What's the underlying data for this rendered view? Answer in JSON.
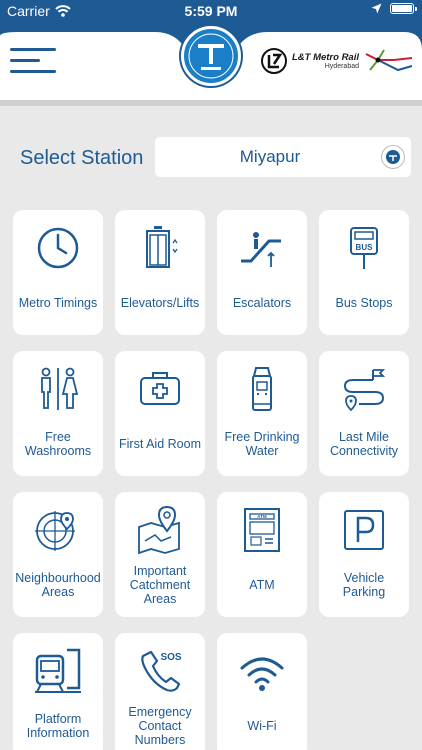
{
  "status_bar": {
    "carrier": "Carrier",
    "time": "5:59 PM"
  },
  "header": {
    "menu_icon": "hamburger-menu-icon",
    "logo_icon": "tsavaari-logo-icon",
    "brand_name": "L&T Metro Rail",
    "brand_city": "Hyderabad"
  },
  "station_select": {
    "label": "Select Station",
    "value": "Miyapur"
  },
  "tiles": [
    {
      "label": "Metro Timings",
      "icon": "clock-icon"
    },
    {
      "label": "Elevators/Lifts",
      "icon": "elevator-icon"
    },
    {
      "label": "Escalators",
      "icon": "escalator-icon"
    },
    {
      "label": "Bus Stops",
      "icon": "bus-stop-icon"
    },
    {
      "label": "Free Washrooms",
      "icon": "washroom-icon"
    },
    {
      "label": "First Aid Room",
      "icon": "first-aid-kit-icon"
    },
    {
      "label": "Free Drinking Water",
      "icon": "water-dispenser-icon"
    },
    {
      "label": "Last Mile Connectivity",
      "icon": "route-icon"
    },
    {
      "label": "Neighbourhood Areas",
      "icon": "neighbourhood-radar-icon"
    },
    {
      "label": "Important Catchment Areas",
      "icon": "map-pin-icon"
    },
    {
      "label": "ATM",
      "icon": "atm-icon"
    },
    {
      "label": "Vehicle Parking",
      "icon": "parking-icon"
    },
    {
      "label": "Platform Information",
      "icon": "platform-train-icon"
    },
    {
      "label": "Emergency Contact Numbers",
      "icon": "sos-phone-icon"
    },
    {
      "label": "Wi-Fi",
      "icon": "wifi-icon"
    }
  ],
  "colors": {
    "primary": "#1e5a94",
    "background": "#e9e9e9",
    "tile": "#ffffff"
  }
}
